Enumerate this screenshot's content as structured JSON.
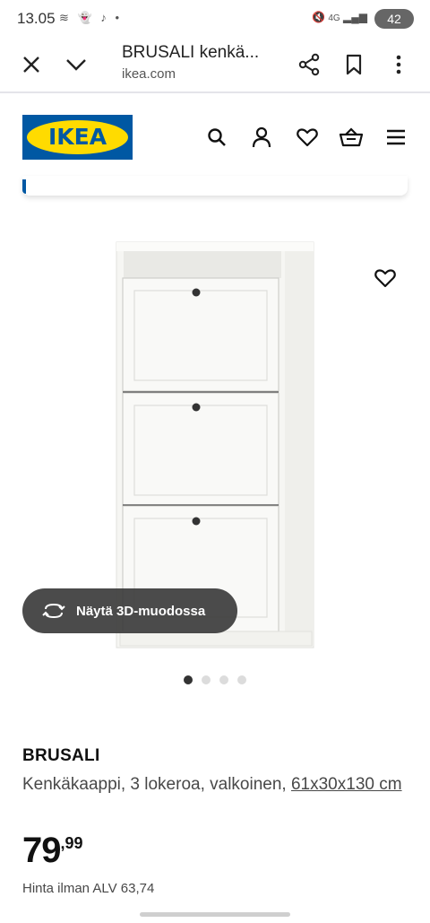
{
  "status_bar": {
    "time": "13.05",
    "left_icons": [
      "wind-icon",
      "snapchat-icon",
      "tiktok-icon",
      "dot-icon"
    ],
    "right_icons": [
      "mute-icon",
      "4g-icon",
      "signal-icon"
    ],
    "network": "4G",
    "battery": "42"
  },
  "browser": {
    "title": "BRUSALI kenkä...",
    "url": "ikea.com"
  },
  "header": {
    "logo_text": "IKEA",
    "colors": {
      "brand_blue": "#0058a3",
      "brand_yellow": "#ffdb00"
    }
  },
  "product": {
    "image_actions": {
      "view_3d_label": "Näytä 3D-muodossa"
    },
    "carousel": {
      "count": 4,
      "active_index": 0
    },
    "name": "BRUSALI",
    "description": "Kenkäkaappi, 3 lokeroa, valkoinen,",
    "dimensions": "61x30x130 cm",
    "price_integer": "79",
    "price_decimal": ",99",
    "vat_note": "Hinta ilman ALV 63,74"
  }
}
